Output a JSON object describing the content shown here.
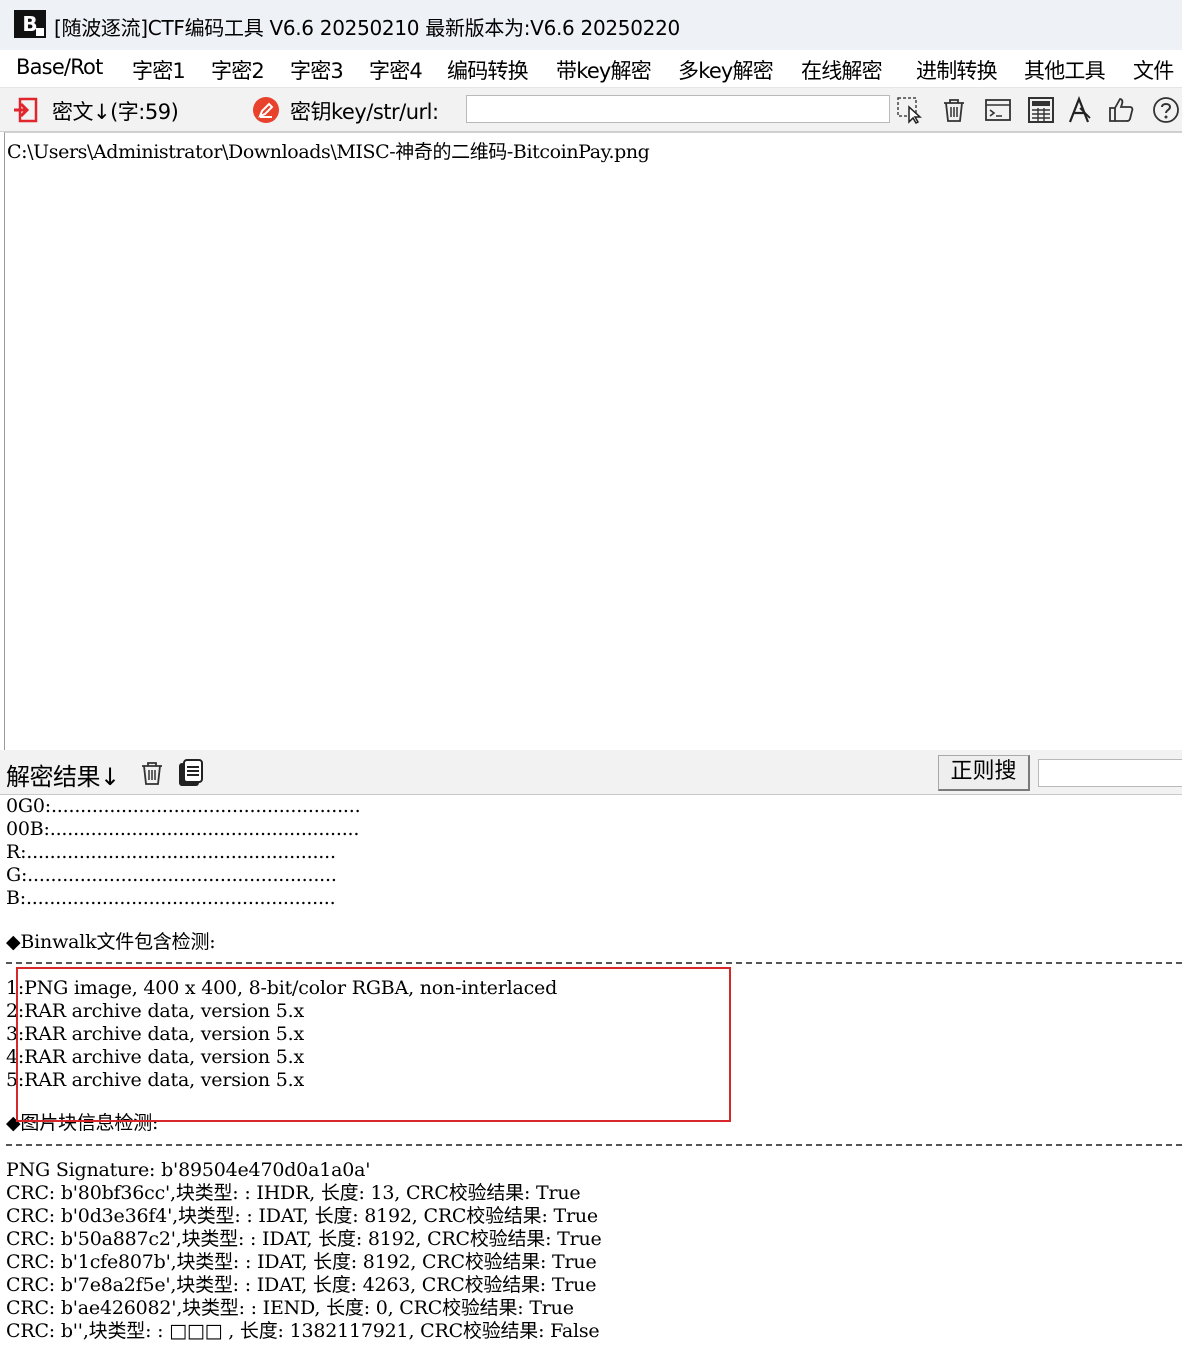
{
  "titlebar": {
    "logo_text": "B",
    "title": "[随波逐流]CTF编码工具 V6.6 20250210    最新版本为:V6.6 20250220"
  },
  "menu": [
    {
      "label": "Base/Rot"
    },
    {
      "label": "字密1"
    },
    {
      "label": "字密2"
    },
    {
      "label": "字密3"
    },
    {
      "label": "字密4"
    },
    {
      "label": "编码转换"
    },
    {
      "label": "带key解密"
    },
    {
      "label": "多key解密"
    },
    {
      "label": "在线解密"
    },
    {
      "label": "进制转换"
    },
    {
      "label": "其他工具"
    },
    {
      "label": "文件"
    }
  ],
  "toolbar": {
    "cipher_label": "密文↓(字:59)",
    "key_label": "密钥key/str/url:",
    "key_value": "",
    "icons": [
      "import-icon",
      "key-icon",
      "cursor-select-icon",
      "trash-icon",
      "terminal-icon",
      "calculator-icon",
      "font-icon",
      "thumbs-up-icon",
      "help-icon"
    ]
  },
  "cipher": {
    "text": "C:\\Users\\Administrator\\Downloads\\MISC-神奇的二维码-BitcoinPay.png"
  },
  "result_bar": {
    "label": "解密结果↓",
    "regex_button": "正则搜",
    "regex_value": ""
  },
  "results": {
    "lines": [
      "0G0:.....................................................",
      "00B:.....................................................",
      "R:.....................................................",
      "G:.....................................................",
      "B:.....................................................",
      "",
      "◆Binwalk文件包含检测:",
      "",
      "1:PNG image, 400 x 400, 8-bit/color RGBA, non-interlaced",
      "2:RAR archive data, version 5.x",
      "3:RAR archive data, version 5.x",
      "4:RAR archive data, version 5.x",
      "5:RAR archive data, version 5.x",
      "",
      "◆图片块信息检测:",
      "",
      "PNG Signature: b'89504e470d0a1a0a'",
      "CRC: b'80bf36cc',块类型: : IHDR, 长度: 13, CRC校验结果: True",
      "CRC: b'0d3e36f4',块类型: : IDAT, 长度: 8192, CRC校验结果: True",
      "CRC: b'50a887c2',块类型: : IDAT, 长度: 8192, CRC校验结果: True",
      "CRC: b'1cfe807b',块类型: : IDAT, 长度: 8192, CRC校验结果: True",
      "CRC: b'7e8a2f5e',块类型: : IDAT, 长度: 4263, CRC校验结果: True",
      "CRC: b'ae426082',块类型: : IEND, 长度: 0, CRC校验结果: True",
      "CRC: b'',块类型: : □□□ , 长度: 1382117921, CRC校验结果: False"
    ]
  },
  "colors": {
    "highlight_box": "#d6272b",
    "import_icon": "#e0262c",
    "key_icon": "#e8412c"
  }
}
